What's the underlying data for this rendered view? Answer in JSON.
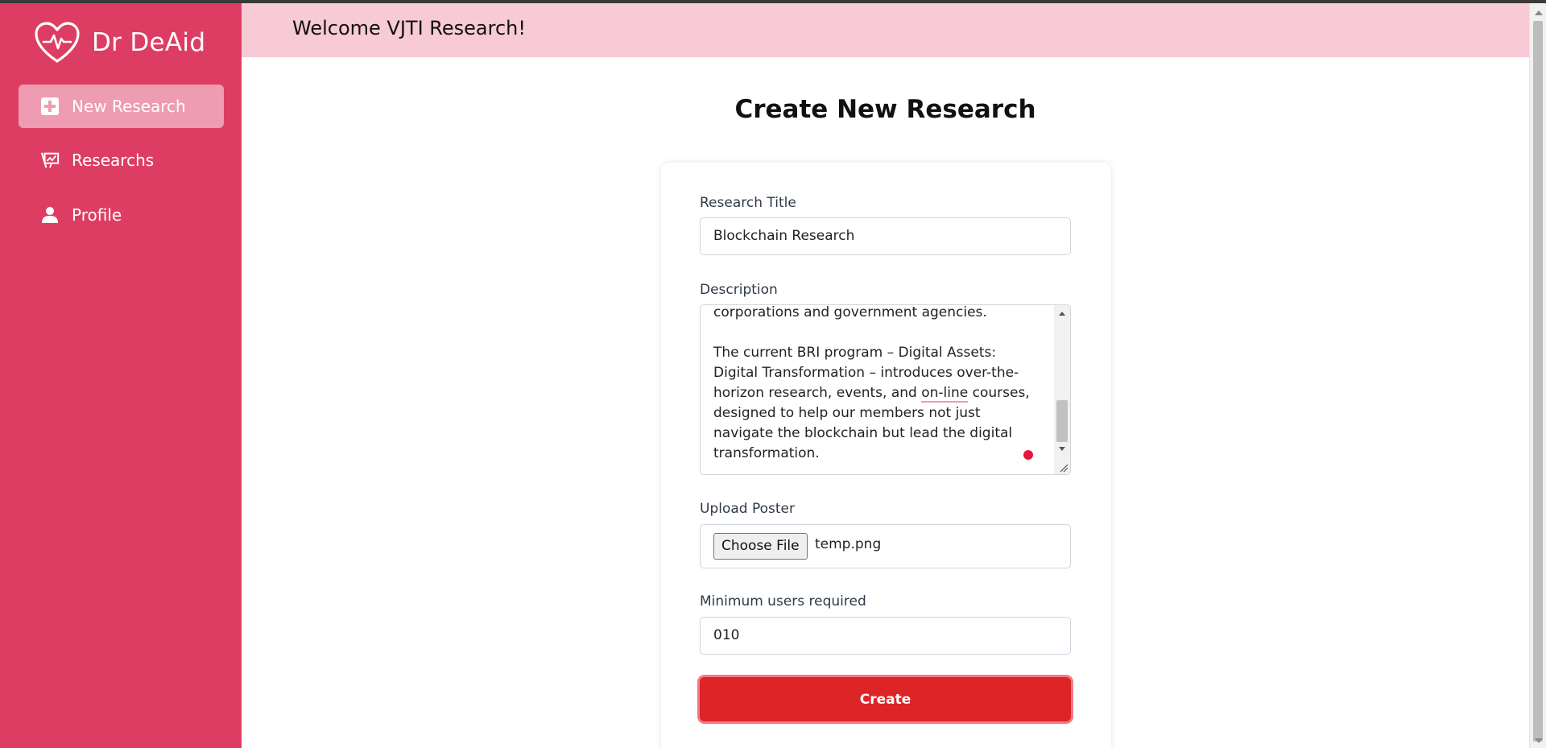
{
  "app": {
    "brand_name": "Dr DeAid",
    "brand_color": "#de3d63",
    "header_color": "#f7cad6",
    "accent_button_color": "#dd2426"
  },
  "sidebar": {
    "items": [
      {
        "label": "New Research",
        "icon": "plus-square-icon",
        "active": true
      },
      {
        "label": "Researchs",
        "icon": "presentation-chart-icon",
        "active": false
      },
      {
        "label": "Profile",
        "icon": "user-icon",
        "active": false
      }
    ]
  },
  "header": {
    "welcome": "Welcome VJTI Research!"
  },
  "page": {
    "title": "Create New Research"
  },
  "form": {
    "title_label": "Research Title",
    "title_value": "Blockchain Research",
    "description_label": "Description",
    "description_lines": {
      "line1": "corporations and government agencies.",
      "line2": "The current BRI program – Digital Assets:",
      "line3": "Digital Transformation – introduces over-the-",
      "line4a": "horizon research, events, and ",
      "line4b": "on-line",
      "line4c": " courses,",
      "line5": "designed to help our members not just",
      "line6": "navigate the blockchain but lead the digital",
      "line7": "transformation."
    },
    "poster_label": "Upload Poster",
    "choose_file_label": "Choose File",
    "file_name": "temp.png",
    "min_users_label": "Minimum users required",
    "min_users_value": "010",
    "submit_label": "Create"
  }
}
